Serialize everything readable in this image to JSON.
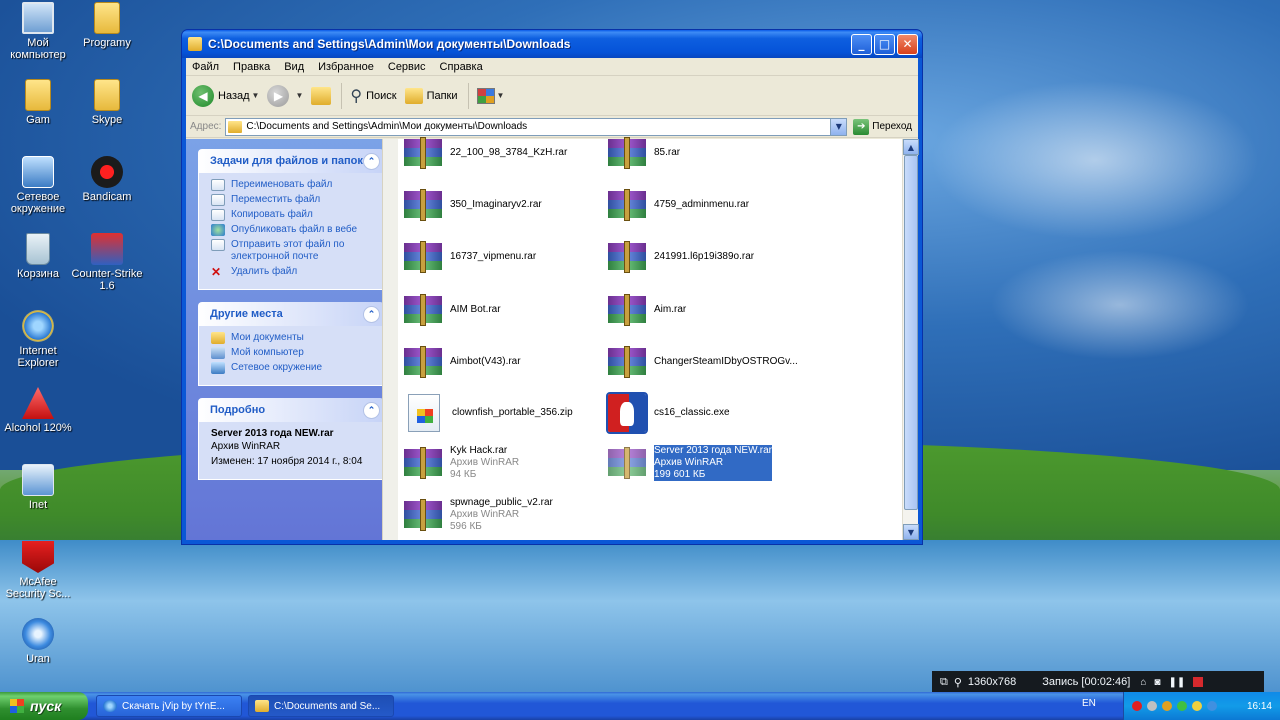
{
  "desktop": {
    "icons": [
      {
        "label": "Мой компьютер",
        "icon": "my-computer-icon"
      },
      {
        "label": "Programy",
        "icon": "folder-icon"
      },
      {
        "label": "Gam",
        "icon": "folder-icon"
      },
      {
        "label": "Skype",
        "icon": "folder-icon"
      },
      {
        "label": "Сетевое окружение",
        "icon": "network-places-icon"
      },
      {
        "label": "Bandicam",
        "icon": "bandicam-icon"
      },
      {
        "label": "Корзина",
        "icon": "recycle-bin-icon"
      },
      {
        "label": "Counter-Strike 1.6",
        "icon": "counter-strike-icon"
      },
      {
        "label": "Internet Explorer",
        "icon": "internet-explorer-icon"
      },
      {
        "label": "Alcohol 120%",
        "icon": "alcohol-icon"
      },
      {
        "label": "Inet",
        "icon": "inet-icon"
      },
      {
        "label": "McAfee Security Sc...",
        "icon": "mcafee-icon"
      },
      {
        "label": "Uran",
        "icon": "uran-icon"
      }
    ]
  },
  "window": {
    "title": "C:\\Documents and Settings\\Admin\\Мои документы\\Downloads",
    "controls": {
      "minimize": "_",
      "maximize": "□",
      "close": "✕"
    },
    "menu": [
      "Файл",
      "Правка",
      "Вид",
      "Избранное",
      "Сервис",
      "Справка"
    ],
    "toolbar": {
      "back": "Назад",
      "search": "Поиск",
      "folders": "Папки"
    },
    "address": {
      "label": "Адрес:",
      "value": "C:\\Documents and Settings\\Admin\\Мои документы\\Downloads",
      "go": "Переход"
    }
  },
  "tasks": {
    "title": "Задачи для файлов и папок",
    "items": [
      "Переименовать файл",
      "Переместить файл",
      "Копировать файл",
      "Опубликовать файл в вебе",
      "Отправить этот файл по электронной почте",
      "Удалить файл"
    ]
  },
  "other_places": {
    "title": "Другие места",
    "items": [
      "Мои документы",
      "Мой компьютер",
      "Сетевое окружение"
    ]
  },
  "details": {
    "title": "Подробно",
    "name": "Server 2013 года NEW.rar",
    "type": "Архив WinRAR",
    "modified": "Изменен: 17 ноября 2014 г., 8:04"
  },
  "files": [
    {
      "name": "22_100_98_3784_KzH.rar",
      "kind": "rar"
    },
    {
      "name": "85.rar",
      "kind": "rar"
    },
    {
      "name": "350_Imaginaryv2.rar",
      "kind": "rar"
    },
    {
      "name": "4759_adminmenu.rar",
      "kind": "rar"
    },
    {
      "name": "16737_vipmenu.rar",
      "kind": "rar"
    },
    {
      "name": "241991.l6p19i389o.rar",
      "kind": "rar"
    },
    {
      "name": "AIM Bot.rar",
      "kind": "rar"
    },
    {
      "name": "Aim.rar",
      "kind": "rar"
    },
    {
      "name": "Aimbot(V43).rar",
      "kind": "rar"
    },
    {
      "name": "ChangerSteamIDbyOSTROGv...",
      "kind": "rar"
    },
    {
      "name": "clownfish_portable_356.zip",
      "kind": "zip"
    },
    {
      "name": "cs16_classic.exe",
      "kind": "exe"
    },
    {
      "name": "Kyk Hack.rar",
      "sub1": "Архив WinRAR",
      "sub2": "94 КБ",
      "kind": "rar"
    },
    {
      "name": "Server 2013 года NEW.rar",
      "sub1": "Архив WinRAR",
      "sub2": "199 601 КБ",
      "kind": "rar",
      "selected": true
    },
    {
      "name": "spwnage_public_v2.rar",
      "sub1": "Архив WinRAR",
      "sub2": "596 КБ",
      "kind": "rar"
    }
  ],
  "taskbar": {
    "start": "пуск",
    "tasks": [
      {
        "label": "Скачать jVip by tYnE...",
        "icon": "internet-explorer-icon"
      },
      {
        "label": "C:\\Documents and Se...",
        "icon": "folder-icon"
      }
    ],
    "language": "EN",
    "clock": "16:14"
  },
  "recording": {
    "resolution": "1360x768",
    "status": "Запись [00:02:46]"
  }
}
